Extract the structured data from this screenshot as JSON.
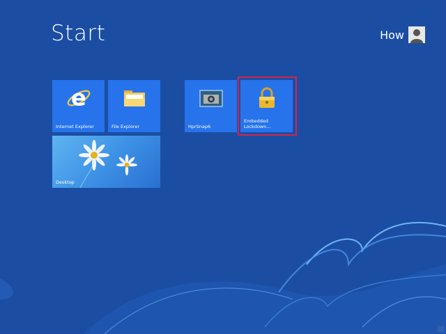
{
  "screen": {
    "title": "Start",
    "user": {
      "name": "How"
    },
    "colors": {
      "background": "#1b4ea3",
      "tile": "#2673ec",
      "selection": "#d2254e"
    },
    "tiles": [
      {
        "label": "Internet Explorer",
        "icon": "internet-explorer-icon",
        "selected": false
      },
      {
        "label": "File Explorer",
        "icon": "folder-icon",
        "selected": false
      },
      {
        "label": "HprSnap6",
        "icon": "camera-icon",
        "selected": false
      },
      {
        "label": "Embedded\nLockdown...",
        "icon": "padlock-icon",
        "selected": true
      },
      {
        "label": "Desktop",
        "icon": "daisy-wallpaper",
        "selected": false
      }
    ]
  }
}
